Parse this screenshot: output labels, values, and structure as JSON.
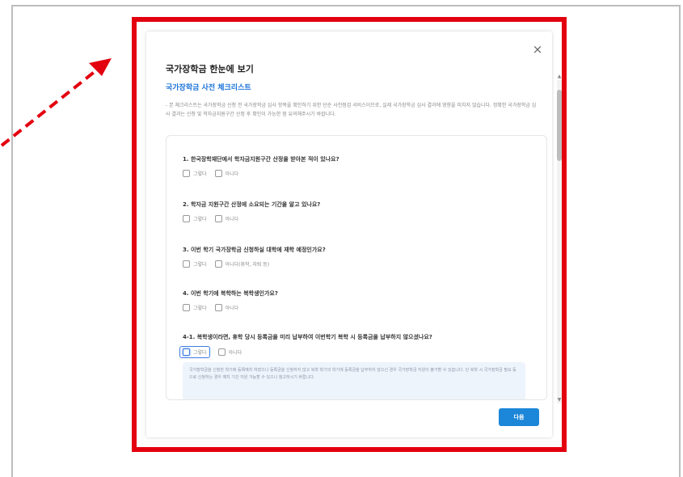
{
  "modal": {
    "close_glyph": "×",
    "title": "국가장학금 한눈에 보기",
    "subtitle": "국가장학금 사전 체크리스트",
    "description": "- 본 체크리스트는 국가장학금 신청 전 국가장학금 심사 항목을 확인하기 위한 단순 사전점검 서비스이므로, 실제 국가장학금 심사 결과에 영향을 미치지 않습니다. 정확한 국가장학금 심사 결과는 신청 및 학자금지원구간 산정 후 확인이 가능한 점 유의해주시기 바랍니다.",
    "next_label": "다음"
  },
  "questions": [
    {
      "text": "1. 한국장학재단에서 학자금지원구간 산정을 받아본 적이 있나요?",
      "options": [
        "그렇다",
        "아니다"
      ]
    },
    {
      "text": "2. 학자금 지원구간 산정에 소요되는 기간을 알고 있나요?",
      "options": [
        "그렇다",
        "아니다"
      ]
    },
    {
      "text": "3. 이번 학기 국가장학금 신청하실 대학에 재학 예정인가요?",
      "options": [
        "그렇다",
        "아니다(휴학, 자퇴 등)"
      ]
    },
    {
      "text": "4. 이번 학기에 복학하는 복학생인가요?",
      "options": [
        "그렇다",
        "아니다"
      ]
    },
    {
      "text": "4-1. 복학생이라면, 휴학 당시 등록금을 미리 납부하여 이번학기 복학 시 등록금을 납부하지 않으셨나요?",
      "options": [
        "그렇다",
        "아니다"
      ]
    }
  ],
  "info_text": "국가장학금을 신청한 학기에 등록예치 하였으나 등록금을 신청하지 않고 복학 학기의 학기에 등록금을 납부하지 않으신 경우 국가장학금 지원이 불가할 수 있습니다. 단 복학 시 국가장학금 필요 등으로 신청하는 경우 예치 기간 지원 가능할 수 있으니 참고하시기 바랍니다.",
  "colors": {
    "highlight": "#e3000f",
    "accent": "#1c86d8",
    "subtitle": "#1a73d9"
  },
  "icons": {
    "annotation_arrow": "red-dashed-arrow-icon",
    "close": "close-icon"
  }
}
